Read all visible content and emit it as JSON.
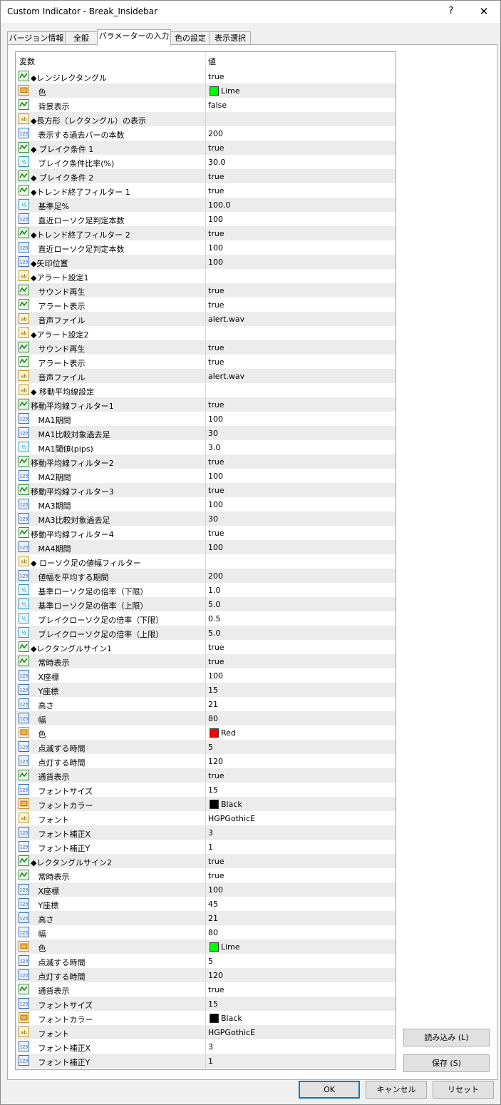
{
  "window": {
    "title": "Custom Indicator - Break_Insidebar",
    "help_label": "?",
    "close_label": "✕"
  },
  "tabs": [
    "バージョン情報",
    "全般",
    "パラメーターの入力",
    "色の設定",
    "表示選択"
  ],
  "table": {
    "header_var": "変数",
    "header_val": "値",
    "rows": [
      {
        "icon": "bool",
        "name": "◆レンジレクタングル",
        "value": "true"
      },
      {
        "icon": "color",
        "name": "   色",
        "value": "Lime",
        "color": "#00ff00"
      },
      {
        "icon": "bool",
        "name": "   背景表示",
        "value": "false"
      },
      {
        "icon": "string",
        "name": "◆長方形（レクタングル）の表示",
        "value": ""
      },
      {
        "icon": "int",
        "name": "   表示する過去バーの本数",
        "value": "200"
      },
      {
        "icon": "bool",
        "name": "◆ ブレイク条件 1",
        "value": "true"
      },
      {
        "icon": "double",
        "name": "   ブレイク条件比率(%)",
        "value": "30.0"
      },
      {
        "icon": "bool",
        "name": "◆ ブレイク条件 2",
        "value": "true"
      },
      {
        "icon": "bool",
        "name": "◆トレンド終了フィルター 1",
        "value": "true"
      },
      {
        "icon": "double",
        "name": "   基準足%",
        "value": "100.0"
      },
      {
        "icon": "int",
        "name": "   直近ローソク足判定本数",
        "value": "100"
      },
      {
        "icon": "bool",
        "name": "◆トレンド終了フィルター 2",
        "value": "true"
      },
      {
        "icon": "int",
        "name": "   直近ローソク足判定本数",
        "value": "100"
      },
      {
        "icon": "int",
        "name": "◆矢印位置",
        "value": "100"
      },
      {
        "icon": "string",
        "name": "◆アラート設定1",
        "value": ""
      },
      {
        "icon": "bool",
        "name": "   サウンド再生",
        "value": "true"
      },
      {
        "icon": "bool",
        "name": "   アラート表示",
        "value": "true"
      },
      {
        "icon": "string",
        "name": "   音声ファイル",
        "value": "alert.wav"
      },
      {
        "icon": "string",
        "name": "◆アラート設定2",
        "value": ""
      },
      {
        "icon": "bool",
        "name": "   サウンド再生",
        "value": "true"
      },
      {
        "icon": "bool",
        "name": "   アラート表示",
        "value": "true"
      },
      {
        "icon": "string",
        "name": "   音声ファイル",
        "value": "alert.wav"
      },
      {
        "icon": "string",
        "name": "◆ 移動平均線設定",
        "value": ""
      },
      {
        "icon": "bool",
        "name": "移動平均線フィルター1",
        "value": "true"
      },
      {
        "icon": "int",
        "name": "   MA1期間",
        "value": "100"
      },
      {
        "icon": "int",
        "name": "   MA1比較対象過去足",
        "value": "30"
      },
      {
        "icon": "double",
        "name": "   MA1閾値(pips)",
        "value": "3.0"
      },
      {
        "icon": "bool",
        "name": "移動平均線フィルター2",
        "value": "true"
      },
      {
        "icon": "int",
        "name": "   MA2期間",
        "value": "100"
      },
      {
        "icon": "bool",
        "name": "移動平均線フィルター3",
        "value": "true"
      },
      {
        "icon": "int",
        "name": "   MA3期間",
        "value": "100"
      },
      {
        "icon": "int",
        "name": "   MA3比較対象過去足",
        "value": "30"
      },
      {
        "icon": "bool",
        "name": "移動平均線フィルター4",
        "value": "true"
      },
      {
        "icon": "int",
        "name": "   MA4期間",
        "value": "100"
      },
      {
        "icon": "string",
        "name": "◆ ローソク足の値幅フィルター",
        "value": ""
      },
      {
        "icon": "int",
        "name": "   値幅を平均する期間",
        "value": "200"
      },
      {
        "icon": "double",
        "name": "   基準ローソク足の倍率（下限）",
        "value": "1.0"
      },
      {
        "icon": "double",
        "name": "   基準ローソク足の倍率（上限）",
        "value": "5.0"
      },
      {
        "icon": "double",
        "name": "   ブレイクローソク足の倍率（下限）",
        "value": "0.5"
      },
      {
        "icon": "double",
        "name": "   ブレイクローソク足の倍率（上限）",
        "value": "5.0"
      },
      {
        "icon": "bool",
        "name": "◆レクタングルサイン1",
        "value": "true"
      },
      {
        "icon": "bool",
        "name": "   常時表示",
        "value": "true"
      },
      {
        "icon": "int",
        "name": "   X座標",
        "value": "100"
      },
      {
        "icon": "int",
        "name": "   Y座標",
        "value": "15"
      },
      {
        "icon": "int",
        "name": "   高さ",
        "value": "21"
      },
      {
        "icon": "int",
        "name": "   幅",
        "value": "80"
      },
      {
        "icon": "color",
        "name": "   色",
        "value": "Red",
        "color": "#ff0000"
      },
      {
        "icon": "int",
        "name": "   点滅する時間",
        "value": "5"
      },
      {
        "icon": "int",
        "name": "   点灯する時間",
        "value": "120"
      },
      {
        "icon": "bool",
        "name": "   通貨表示",
        "value": "true"
      },
      {
        "icon": "int",
        "name": "   フォントサイズ",
        "value": "15"
      },
      {
        "icon": "color",
        "name": "   フォントカラー",
        "value": "Black",
        "color": "#000000"
      },
      {
        "icon": "string",
        "name": "   フォント",
        "value": "HGPGothicE"
      },
      {
        "icon": "int",
        "name": "   フォント補正X",
        "value": "3"
      },
      {
        "icon": "int",
        "name": "   フォント補正Y",
        "value": "1"
      },
      {
        "icon": "bool",
        "name": "◆レクタングルサイン2",
        "value": "true"
      },
      {
        "icon": "bool",
        "name": "   常時表示",
        "value": "true"
      },
      {
        "icon": "int",
        "name": "   X座標",
        "value": "100"
      },
      {
        "icon": "int",
        "name": "   Y座標",
        "value": "45"
      },
      {
        "icon": "int",
        "name": "   高さ",
        "value": "21"
      },
      {
        "icon": "int",
        "name": "   幅",
        "value": "80"
      },
      {
        "icon": "color",
        "name": "   色",
        "value": "Lime",
        "color": "#00ff00"
      },
      {
        "icon": "int",
        "name": "   点滅する時間",
        "value": "5"
      },
      {
        "icon": "int",
        "name": "   点灯する時間",
        "value": "120"
      },
      {
        "icon": "bool",
        "name": "   通貨表示",
        "value": "true"
      },
      {
        "icon": "int",
        "name": "   フォントサイズ",
        "value": "15"
      },
      {
        "icon": "color",
        "name": "   フォントカラー",
        "value": "Black",
        "color": "#000000"
      },
      {
        "icon": "string",
        "name": "   フォント",
        "value": "HGPGothicE"
      },
      {
        "icon": "int",
        "name": "   フォント補正X",
        "value": "3"
      },
      {
        "icon": "int",
        "name": "   フォント補正Y",
        "value": "1"
      }
    ]
  },
  "buttons": {
    "load": "読み込み (L)",
    "save": "保存 (S)",
    "ok": "OK",
    "cancel": "キャンセル",
    "reset": "リセット"
  }
}
